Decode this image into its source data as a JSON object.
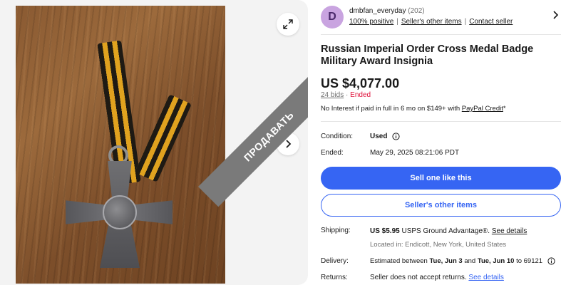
{
  "gallery": {
    "banner_text": "ПРОДАВАТЬ"
  },
  "seller": {
    "avatar_letter": "D",
    "name": "dmbfan_everyday",
    "rating": "(202)",
    "positive": "100% positive",
    "other_items": "Seller's other items",
    "contact": "Contact seller"
  },
  "listing": {
    "title": "Russian Imperial Order Cross Medal Badge Military Award Insignia",
    "price": "US $4,077.00",
    "bids": "24 bids",
    "separator": "·",
    "status": "Ended",
    "finance_text": "No Interest if paid in full in 6 mo on $149+ with",
    "finance_link": "PayPal Credit",
    "finance_suffix": "*"
  },
  "details": {
    "condition_label": "Condition:",
    "condition_value": "Used",
    "ended_label": "Ended:",
    "ended_value": "May 29, 2025 08:21:06 PDT"
  },
  "actions": {
    "sell_one": "Sell one like this",
    "other_items": "Seller's other items"
  },
  "shipping": {
    "label": "Shipping:",
    "cost": "US $5.95",
    "service": "USPS Ground Advantage",
    "reg": "®",
    "period": ".",
    "see_details": "See details",
    "location": "Located in: Endicott, New York, United States"
  },
  "delivery": {
    "label": "Delivery:",
    "prefix": "Estimated between",
    "start": "Tue, Jun 3",
    "and": "and",
    "end": "Tue, Jun 10",
    "to": "to 69121"
  },
  "returns": {
    "label": "Returns:",
    "text": "Seller does not accept returns.",
    "see_details": "See details"
  },
  "colors": {
    "accent": "#3665f3",
    "ended": "#e0103a",
    "avatar_bg": "#c9a4e0"
  }
}
